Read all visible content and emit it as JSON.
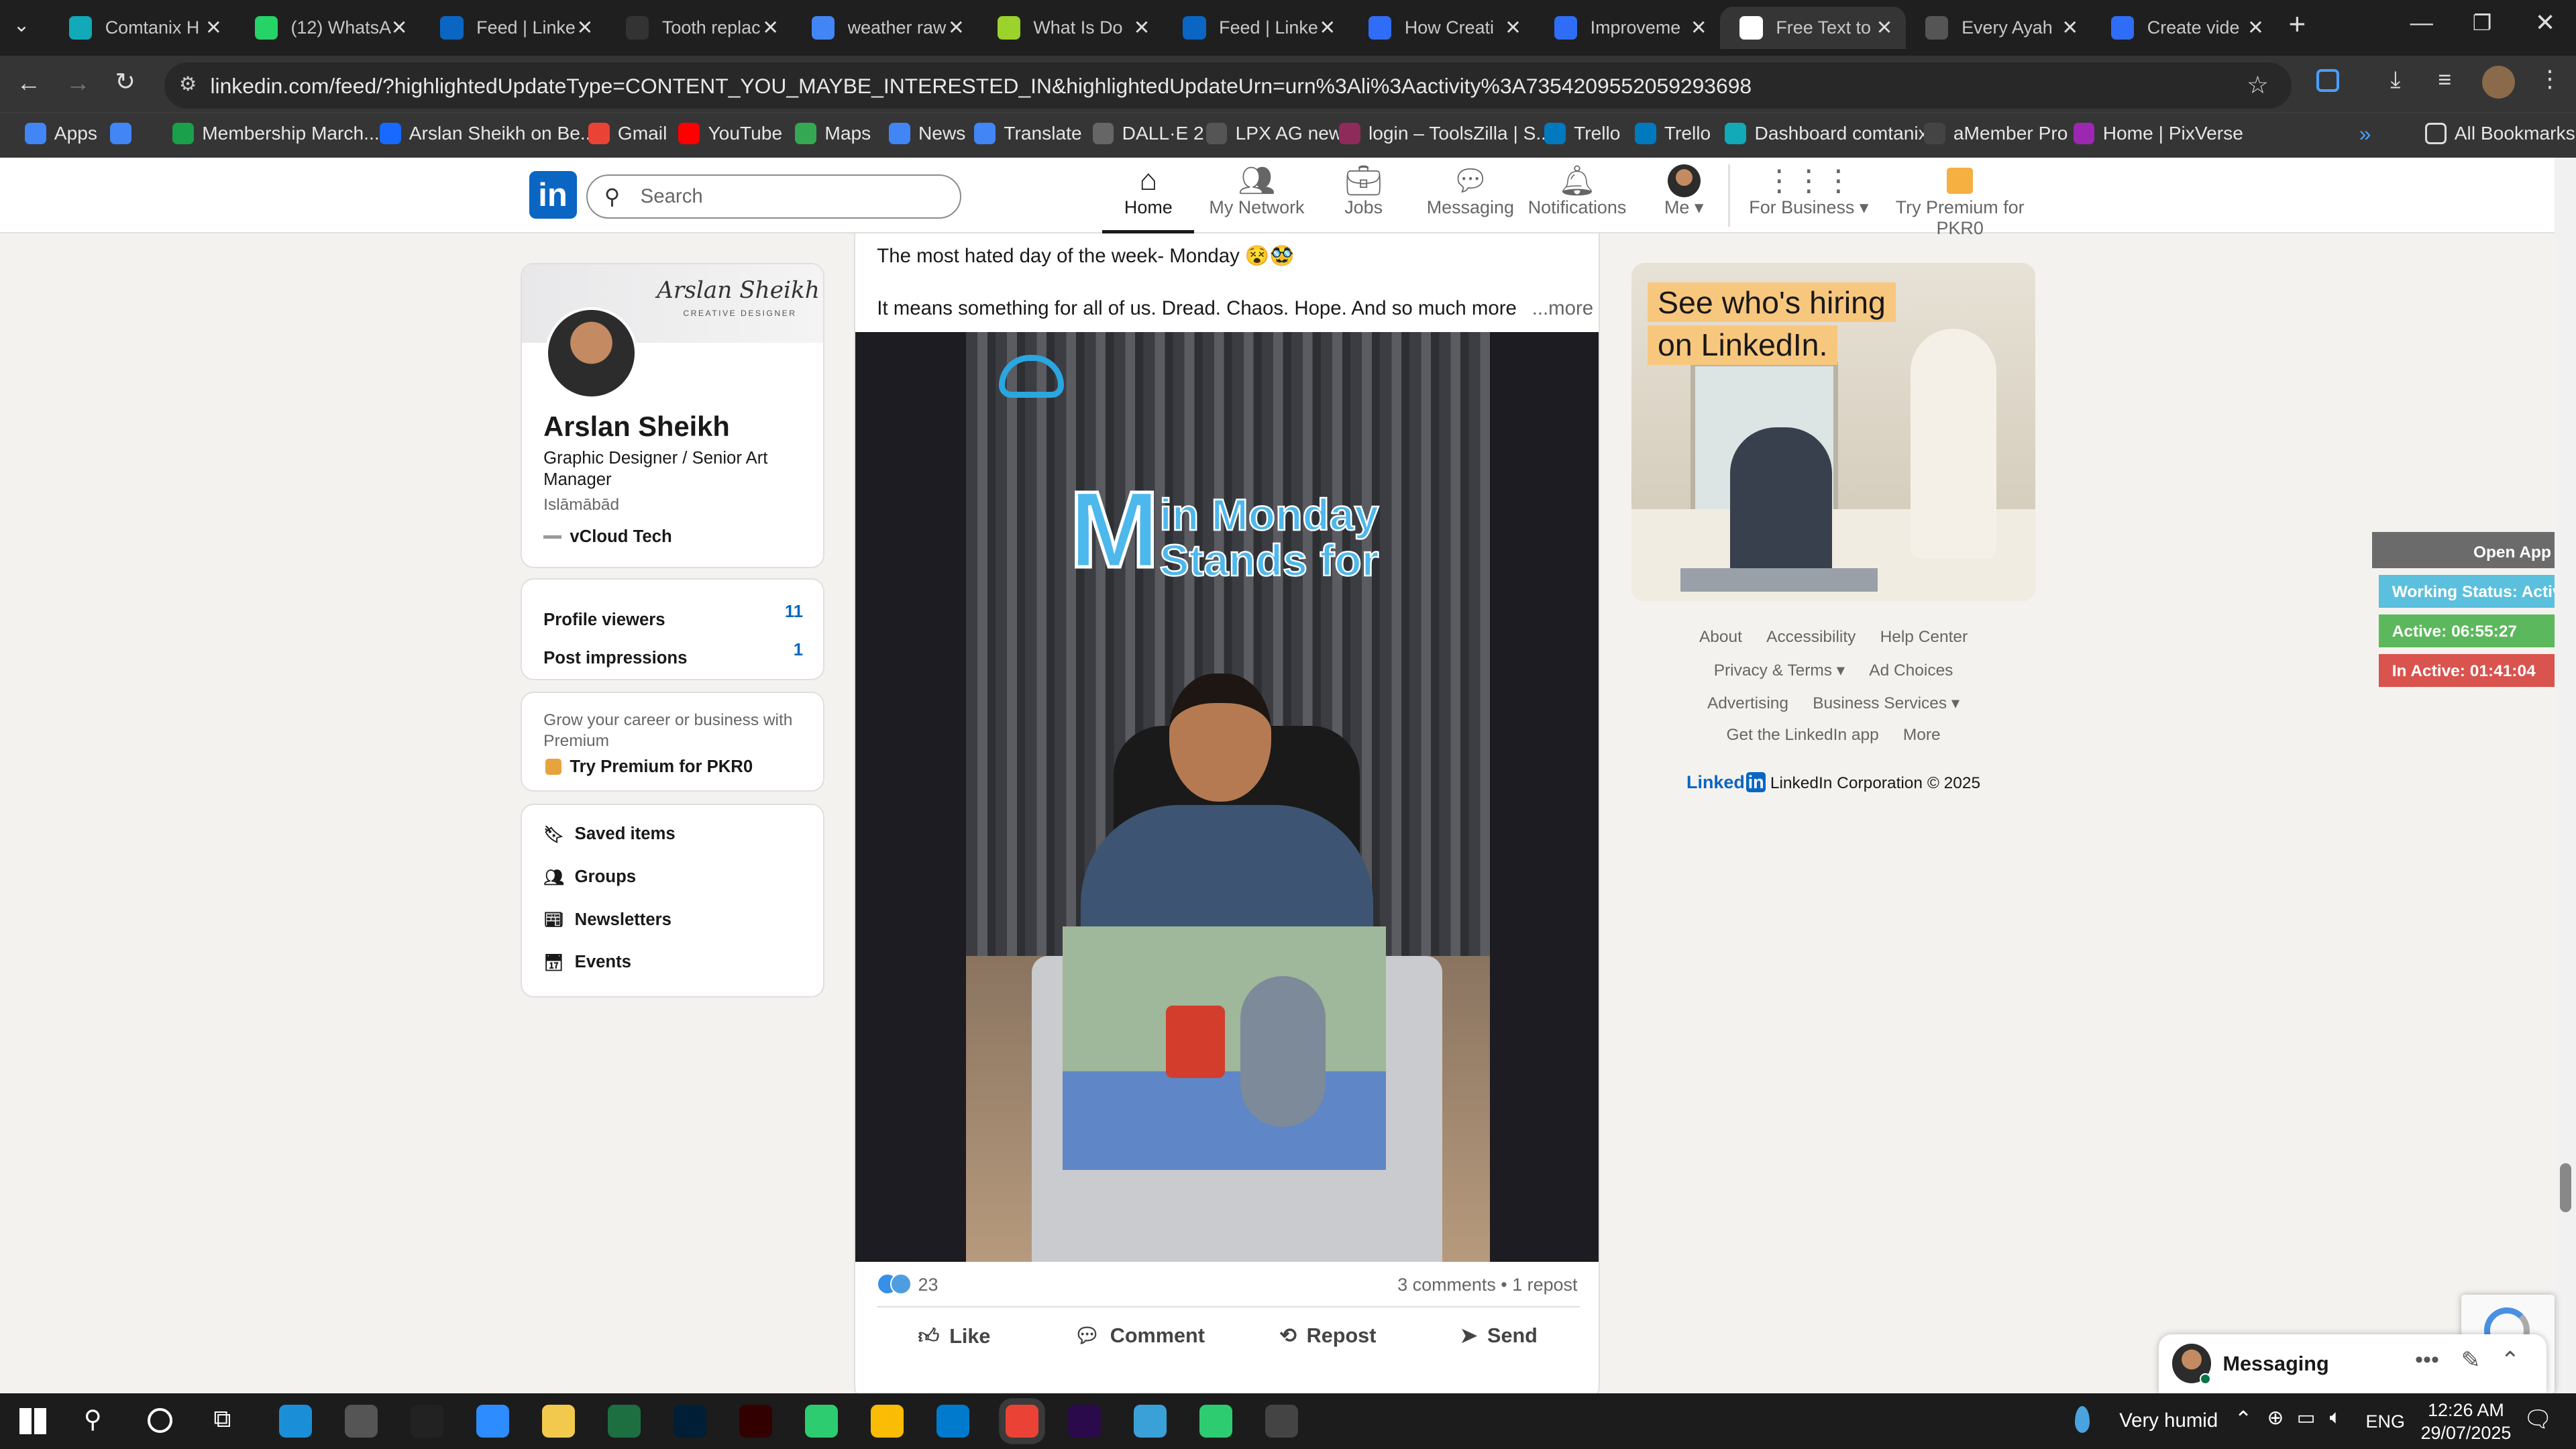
{
  "browser": {
    "tabs": [
      {
        "title": "Comtanix H",
        "color": "#12a9b8"
      },
      {
        "title": "(12) WhatsA",
        "color": "#25d366"
      },
      {
        "title": "Feed | Linke",
        "color": "#0a66c2"
      },
      {
        "title": "Tooth replac",
        "color": "#333333"
      },
      {
        "title": "weather raw",
        "color": "#4285f4"
      },
      {
        "title": "What Is Do",
        "color": "#9bd22b"
      },
      {
        "title": "Feed | Linke",
        "color": "#0a66c2"
      },
      {
        "title": "How Creati",
        "color": "#2f6df6"
      },
      {
        "title": "Improveme",
        "color": "#2f6df6"
      },
      {
        "title": "Free Text to",
        "color": "#ffffff"
      },
      {
        "title": "Every Ayah",
        "color": "#555555"
      },
      {
        "title": "Create vide",
        "color": "#2f6df6"
      }
    ],
    "url": "linkedin.com/feed/?highlightedUpdateType=CONTENT_YOU_MAYBE_INTERESTED_IN&highlightedUpdateUrn=urn%3Ali%3Aactivity%3A7354209552059293698",
    "bookmarks": [
      {
        "label": "Apps",
        "color": "#4285f4"
      },
      {
        "label": "",
        "color": "#4285f4"
      },
      {
        "label": "Membership March...",
        "color": "#1a9f4b"
      },
      {
        "label": "Arslan Sheikh on Be...",
        "color": "#1769ff"
      },
      {
        "label": "Gmail",
        "color": "#ea4335"
      },
      {
        "label": "YouTube",
        "color": "#ff0000"
      },
      {
        "label": "Maps",
        "color": "#34a853"
      },
      {
        "label": "News",
        "color": "#4285f4"
      },
      {
        "label": "Translate",
        "color": "#4285f4"
      },
      {
        "label": "DALL·E 2",
        "color": "#666666"
      },
      {
        "label": "LPX AG new",
        "color": "#555555"
      },
      {
        "label": "login – ToolsZilla | S...",
        "color": "#8e2b5a"
      },
      {
        "label": "Trello",
        "color": "#0079bf"
      },
      {
        "label": "Trello",
        "color": "#0079bf"
      },
      {
        "label": "Dashboard comtanix",
        "color": "#12a9b8"
      },
      {
        "label": "aMember Pro",
        "color": "#444444"
      },
      {
        "label": "Home | PixVerse",
        "color": "#9c27b0"
      }
    ],
    "all_bookmarks": "All Bookmarks"
  },
  "nav": {
    "search_placeholder": "Search",
    "items": [
      {
        "label": "Home",
        "icon": "home-icon"
      },
      {
        "label": "My Network",
        "icon": "network-icon"
      },
      {
        "label": "Jobs",
        "icon": "briefcase-icon"
      },
      {
        "label": "Messaging",
        "icon": "messaging-icon"
      },
      {
        "label": "Notifications",
        "icon": "bell-icon"
      },
      {
        "label": "Me",
        "icon": "avatar"
      },
      {
        "label": "For Business",
        "icon": "grid-icon"
      },
      {
        "label": "Try Premium for PKR0",
        "icon": "premium-icon"
      }
    ]
  },
  "profile": {
    "banner_title": "Arslan Sheikh",
    "banner_subtitle": "CREATIVE DESIGNER",
    "name": "Arslan Sheikh",
    "headline": "Graphic Designer / Senior Art Manager",
    "location": "Islāmābād",
    "company": "vCloud Tech",
    "stats": [
      {
        "label": "Profile viewers",
        "value": "11"
      },
      {
        "label": "Post impressions",
        "value": "1"
      }
    ],
    "premium_text": "Grow your career or business with Premium",
    "premium_link": "Try Premium for PKR0",
    "shortcuts": [
      {
        "label": "Saved items",
        "icon": "bookmark-icon"
      },
      {
        "label": "Groups",
        "icon": "groups-icon"
      },
      {
        "label": "Newsletters",
        "icon": "newsletter-icon"
      },
      {
        "label": "Events",
        "icon": "calendar-icon"
      }
    ]
  },
  "post": {
    "text1": "The most hated day of the week- Monday 😵🥸",
    "text2": "It means something for all of us. Dread. Chaos. Hope. And so much more",
    "more": "...more",
    "video_title_letter": "M",
    "video_title_line1": "in Monday",
    "video_title_line2": "Stands for",
    "reactions": "23",
    "comments_reposts": "3 comments • 1 repost",
    "actions": [
      {
        "label": "Like",
        "icon": "like-icon"
      },
      {
        "label": "Comment",
        "icon": "comment-icon"
      },
      {
        "label": "Repost",
        "icon": "repost-icon"
      },
      {
        "label": "Send",
        "icon": "send-icon"
      }
    ]
  },
  "ad": {
    "line1": "See who's hiring",
    "line2": "on LinkedIn."
  },
  "footer": {
    "links_row1": [
      "About",
      "Accessibility",
      "Help Center"
    ],
    "links_row2": [
      "Privacy & Terms ▾",
      "Ad Choices"
    ],
    "links_row3": [
      "Advertising",
      "Business Services ▾"
    ],
    "links_row4": [
      "Get the LinkedIn app",
      "More"
    ],
    "brand": "Linked",
    "copyright": "LinkedIn Corporation © 2025"
  },
  "widget": {
    "open_app": "Open App ↗",
    "working_status": "Working Status: Active",
    "active": "Active: 06:55:27",
    "inactive": "In Active: 01:41:04"
  },
  "messaging": {
    "label": "Messaging"
  },
  "taskbar": {
    "weather": "Very humid",
    "lang": "ENG",
    "time": "12:26 AM",
    "date": "29/07/2025"
  }
}
